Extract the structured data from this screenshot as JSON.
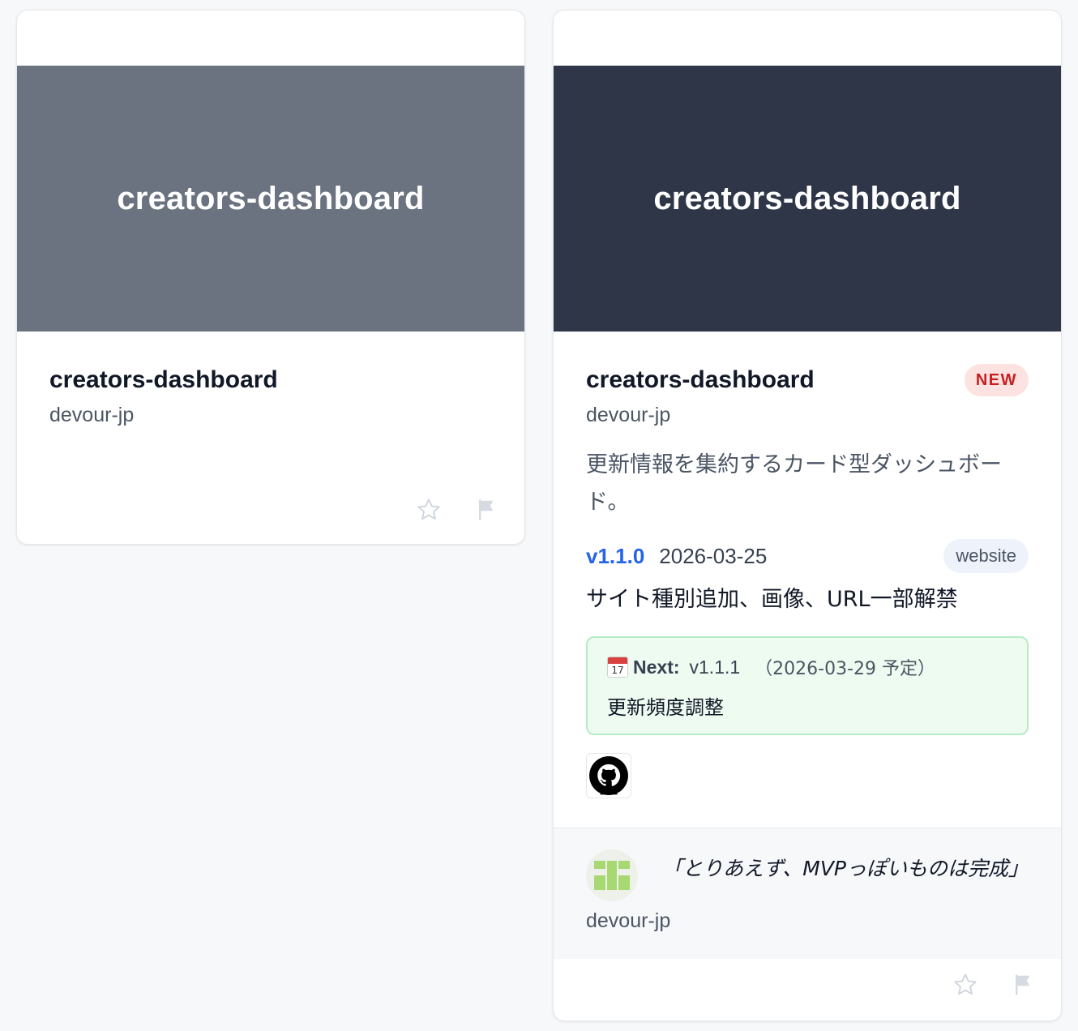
{
  "cards": [
    {
      "banner_title": "creators-dashboard",
      "banner_color": "#6b7280",
      "title": "creators-dashboard",
      "owner": "devour-jp"
    },
    {
      "banner_title": "creators-dashboard",
      "banner_color": "#2e3648",
      "title": "creators-dashboard",
      "badge": "NEW",
      "owner": "devour-jp",
      "description": "更新情報を集約するカード型ダッシュボード。",
      "release": {
        "version": "v1.1.0",
        "date": "2026-03-25",
        "tag": "website",
        "note": "サイト種別追加、画像、URL一部解禁"
      },
      "next": {
        "calendar_day": "17",
        "label": "Next:",
        "version": "v1.1.1",
        "date": "（2026-03-29 予定）",
        "note": "更新頻度調整"
      },
      "comment": {
        "quote": "「とりあえず、MVPっぽいものは完成」",
        "owner": "devour-jp"
      }
    }
  ],
  "icons": {
    "star": "star-icon",
    "flag": "flag-icon",
    "github": "github-icon",
    "calendar": "calendar-icon"
  }
}
